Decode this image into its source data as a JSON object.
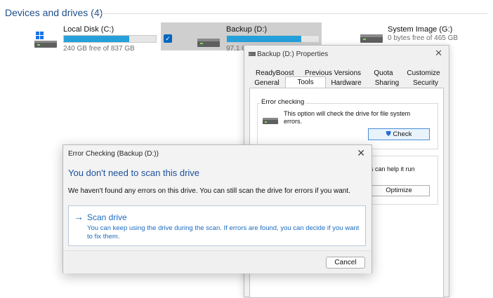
{
  "explorer": {
    "section_title": "Devices and drives (4)",
    "drives": [
      {
        "name": "Local Disk (C:)",
        "free_text": "240 GB free of 837 GB",
        "used_fraction": 0.71,
        "bar_color": "#26a0da",
        "icon": "windows-drive-icon"
      },
      {
        "name": "Backup (D:)",
        "free_text": "97.1 G",
        "used_fraction": 0.81,
        "bar_color": "#26a0da",
        "icon": "hard-drive-icon",
        "selected": true
      },
      {
        "name": "System Image (G:)",
        "free_text": "0 bytes free of 465 GB",
        "icon": "hard-drive-icon"
      }
    ]
  },
  "properties_dialog": {
    "title": "Backup (D:) Properties",
    "tabs_row1": [
      "ReadyBoost",
      "Previous Versions",
      "Quota",
      "Customize"
    ],
    "tabs_row2": [
      "General",
      "Tools",
      "Hardware",
      "Sharing",
      "Security"
    ],
    "active_tab": "Tools",
    "error_checking": {
      "label": "Error checking",
      "text": "This option will check the drive for file system errors.",
      "button": "Check"
    },
    "optimize": {
      "partial_text": "s can help it run",
      "button": "Optimize"
    }
  },
  "error_dialog": {
    "title": "Error Checking (Backup (D:))",
    "heading": "You don't need to scan this drive",
    "message": "We haven't found any errors on this drive. You can still scan the drive for errors if you want.",
    "scan_option": {
      "arrow": "→",
      "title": "Scan drive",
      "description": "You can keep using the drive during the scan. If errors are found, you can decide if you want to fix them."
    },
    "cancel": "Cancel",
    "close_glyph": "✕"
  },
  "colors": {
    "accent": "#0067c0",
    "link_blue": "#1c6bbf",
    "heading_blue": "#1c4f9c",
    "drive_bar": "#26a0da"
  }
}
